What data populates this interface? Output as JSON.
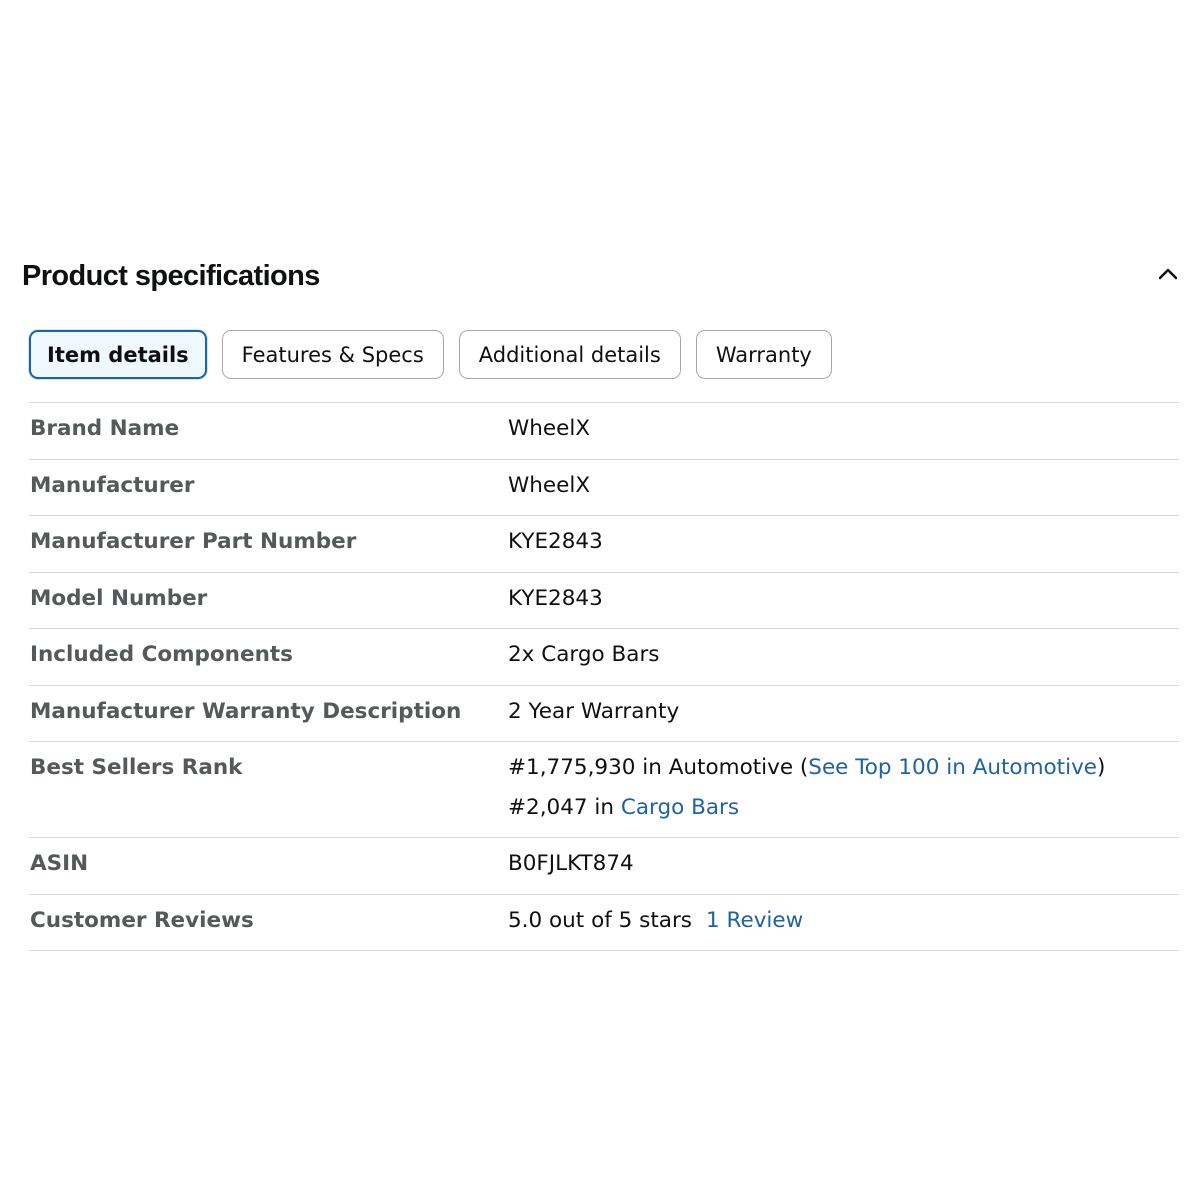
{
  "section": {
    "title": "Product specifications",
    "toggle_icon": "chevron-up-icon"
  },
  "tabs": [
    {
      "label": "Item details",
      "active": true
    },
    {
      "label": "Features & Specs",
      "active": false
    },
    {
      "label": "Additional details",
      "active": false
    },
    {
      "label": "Warranty",
      "active": false
    }
  ],
  "specs": {
    "brand_name": {
      "label": "Brand Name",
      "value": "WheelX"
    },
    "manufacturer": {
      "label": "Manufacturer",
      "value": "WheelX"
    },
    "part_number": {
      "label": "Manufacturer Part Number",
      "value": "KYE2843"
    },
    "model_number": {
      "label": "Model Number",
      "value": "KYE2843"
    },
    "included_components": {
      "label": "Included Components",
      "value": "2x Cargo Bars"
    },
    "warranty_description": {
      "label": "Manufacturer Warranty Description",
      "value": "2 Year Warranty"
    },
    "best_sellers_rank": {
      "label": "Best Sellers Rank",
      "rank1_text": "#1,775,930 in Automotive (",
      "rank1_link": "See Top 100 in Automotive",
      "rank1_close": ")",
      "rank2_text": "#2,047 in ",
      "rank2_link": "Cargo Bars"
    },
    "asin": {
      "label": "ASIN",
      "value": "B0FJLKT874"
    },
    "customer_reviews": {
      "label": "Customer Reviews",
      "rating_text": "5.0 out of 5 stars",
      "review_link": "1 Review"
    }
  },
  "colors": {
    "link": "#2162a1",
    "label": "#565959",
    "text": "#0f1111",
    "divider": "#d5d9d9"
  }
}
